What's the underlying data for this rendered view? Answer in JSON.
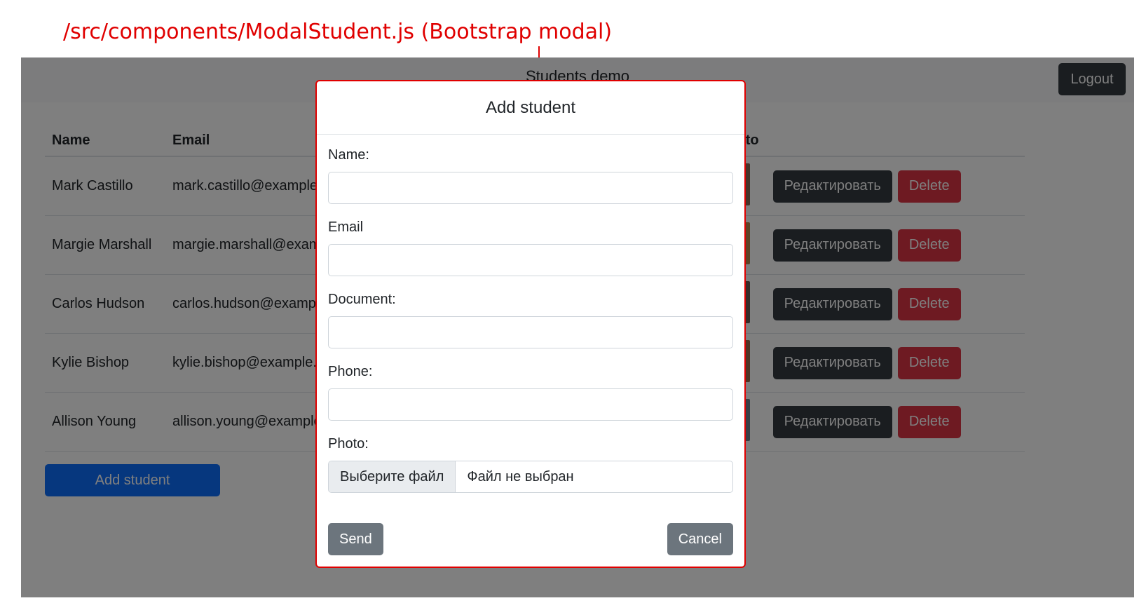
{
  "annotation": {
    "text": "/src/components/ModalStudent.js (Bootstrap modal)"
  },
  "navbar": {
    "title": "Students demo",
    "logout_label": "Logout"
  },
  "table": {
    "headers": {
      "name": "Name",
      "email": "Email",
      "photo": "Photo"
    },
    "rows": [
      {
        "name": "Mark Castillo",
        "email": "mark.castillo@example.com",
        "photo_color": "#8a6a55"
      },
      {
        "name": "Margie Marshall",
        "email": "margie.marshall@example.com",
        "photo_color": "#b9894c"
      },
      {
        "name": "Carlos Hudson",
        "email": "carlos.hudson@example.com",
        "photo_color": "#6d5a52"
      },
      {
        "name": "Kylie Bishop",
        "email": "kylie.bishop@example.com",
        "photo_color": "#9c6a4a"
      },
      {
        "name": "Allison Young",
        "email": "allison.young@example.com",
        "photo_color": "#6f7f8a"
      }
    ],
    "edit_label": "Редактировать",
    "delete_label": "Delete"
  },
  "add_student_button": "Add student",
  "modal": {
    "title": "Add student",
    "fields": {
      "name_label": "Name:",
      "email_label": "Email",
      "document_label": "Document:",
      "phone_label": "Phone:",
      "photo_label": "Photo:"
    },
    "file_button": "Выберите файл",
    "file_status": "Файл не выбран",
    "send_label": "Send",
    "cancel_label": "Cancel"
  },
  "colors": {
    "annotation": "#e00000",
    "primary": "#0d6efd",
    "danger": "#dc3545",
    "dark": "#343a40",
    "secondary": "#6c757d"
  }
}
